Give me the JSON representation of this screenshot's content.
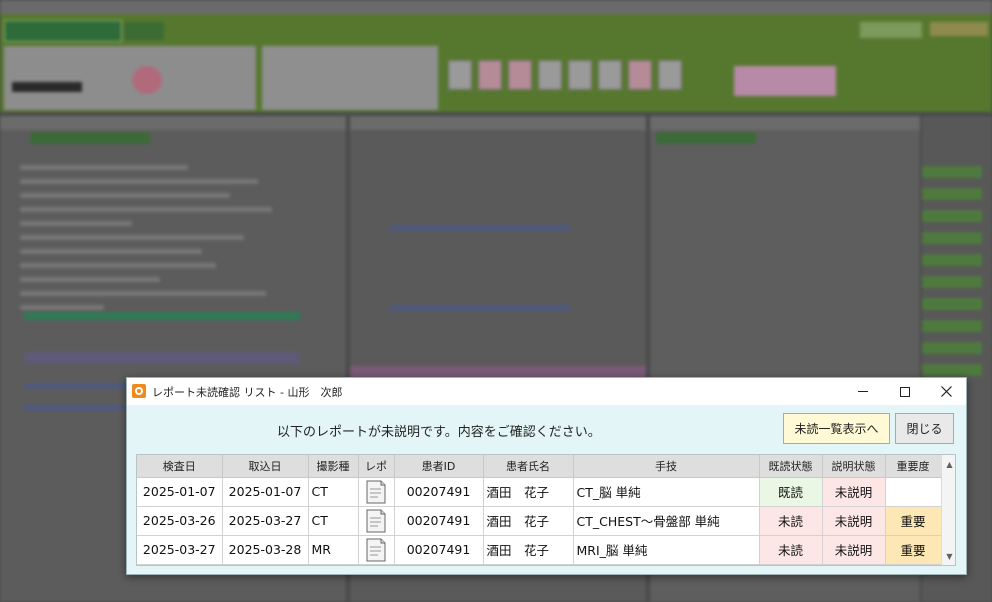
{
  "dialog": {
    "title": "レポート未読確認 リスト - 山形　次郎",
    "message": "以下のレポートが未説明です。内容をご確認ください。",
    "buttons": {
      "show_unread": "未読一覧表示へ",
      "close": "閉じる"
    },
    "window_controls": {
      "minimize": "minimize-icon",
      "maximize": "maximize-icon",
      "close": "close-icon"
    }
  },
  "table": {
    "columns": [
      "検査日",
      "取込日",
      "撮影種",
      "レポ",
      "患者ID",
      "患者氏名",
      "手技",
      "既読状態",
      "説明状態",
      "重要度"
    ],
    "rows": [
      {
        "exam_date": "2025-01-07",
        "import_date": "2025-01-07",
        "modality": "CT",
        "report_icon": "report-document-icon",
        "patient_id": "00207491",
        "patient_name": "酒田　花子",
        "procedure": "CT_脳 単純",
        "read_status": "既読",
        "explain_status": "未説明",
        "importance": ""
      },
      {
        "exam_date": "2025-03-26",
        "import_date": "2025-03-27",
        "modality": "CT",
        "report_icon": "report-document-icon",
        "patient_id": "00207491",
        "patient_name": "酒田　花子",
        "procedure": "CT_CHEST〜骨盤部 単純",
        "read_status": "未読",
        "explain_status": "未説明",
        "importance": "重要"
      },
      {
        "exam_date": "2025-03-27",
        "import_date": "2025-03-28",
        "modality": "MR",
        "report_icon": "report-document-icon",
        "patient_id": "00207491",
        "patient_name": "酒田　花子",
        "procedure": "MRI_脳 単純",
        "read_status": "未読",
        "explain_status": "未説明",
        "importance": "重要"
      }
    ]
  },
  "colors": {
    "dialog_bg": "#e4f5f7",
    "read_bg": "#eaf7e4",
    "unread_bg": "#fce6e6",
    "important_bg": "#fde7b4",
    "primary_button_bg": "#fff9d6",
    "app_icon": "#f08a1c"
  }
}
